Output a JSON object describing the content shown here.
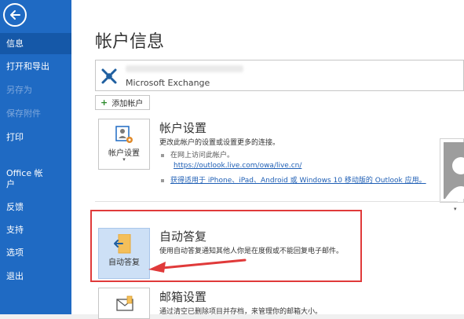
{
  "sidebar": {
    "items": [
      {
        "label": "信息",
        "state": "active"
      },
      {
        "label": "打开和导出",
        "state": "normal"
      },
      {
        "label": "另存为",
        "state": "disabled"
      },
      {
        "label": "保存附件",
        "state": "disabled"
      },
      {
        "label": "打印",
        "state": "normal"
      },
      {
        "label": "Office 帐户",
        "state": "normal"
      },
      {
        "label": "反馈",
        "state": "normal"
      },
      {
        "label": "支持",
        "state": "normal"
      },
      {
        "label": "选项",
        "state": "normal"
      },
      {
        "label": "退出",
        "state": "normal"
      }
    ]
  },
  "page": {
    "title": "帐户信息"
  },
  "account": {
    "type_label": "Microsoft Exchange"
  },
  "add_account": {
    "label": "添加帐户"
  },
  "account_settings": {
    "tile_label": "帐户设置",
    "title": "帐户设置",
    "description": "更改此帐户的设置或设置更多的连接。",
    "bullet1": "在网上访问此帐户。",
    "link1": "https://outlook.live.com/owa/live.cn/",
    "bullet2": "获得适用于 iPhone、iPad、Android 或 Windows 10 移动版的 Outlook 应用。"
  },
  "auto_reply": {
    "tile_label": "自动答复",
    "title": "自动答复",
    "description": "使用自动答复通知其他人你是在度假或不能回复电子邮件。"
  },
  "mailbox_settings": {
    "title": "邮箱设置",
    "description": "通过清空已删除项目并存档，来管理你的邮箱大小。"
  },
  "colors": {
    "sidebar_bg": "#1f6ac3",
    "sidebar_active": "#1558a8",
    "annotation_red": "#e03a3a",
    "link": "#1f5fb5"
  }
}
